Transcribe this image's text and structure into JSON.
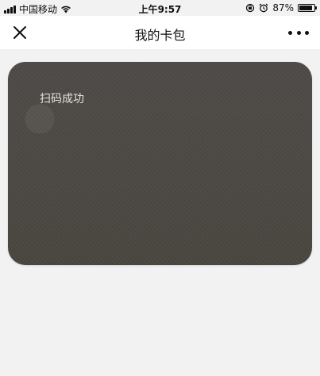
{
  "status_bar": {
    "carrier": "中国移动",
    "time": "上午9:57",
    "battery_percent_text": "87%",
    "battery_level": 0.87,
    "signal_icon": "cellular-signal-icon",
    "wifi_icon": "wifi-icon",
    "lock_icon": "rotation-lock-icon",
    "alarm_icon": "alarm-clock-icon"
  },
  "nav": {
    "title": "我的卡包",
    "close_icon": "close-icon",
    "more_icon": "more-dots-icon"
  },
  "card": {
    "status_text": "扫码成功",
    "color": "#4b4744",
    "text_color": "#e8e2dc"
  },
  "colors": {
    "page_background": "#f2f2f2",
    "nav_background": "#ffffff"
  }
}
